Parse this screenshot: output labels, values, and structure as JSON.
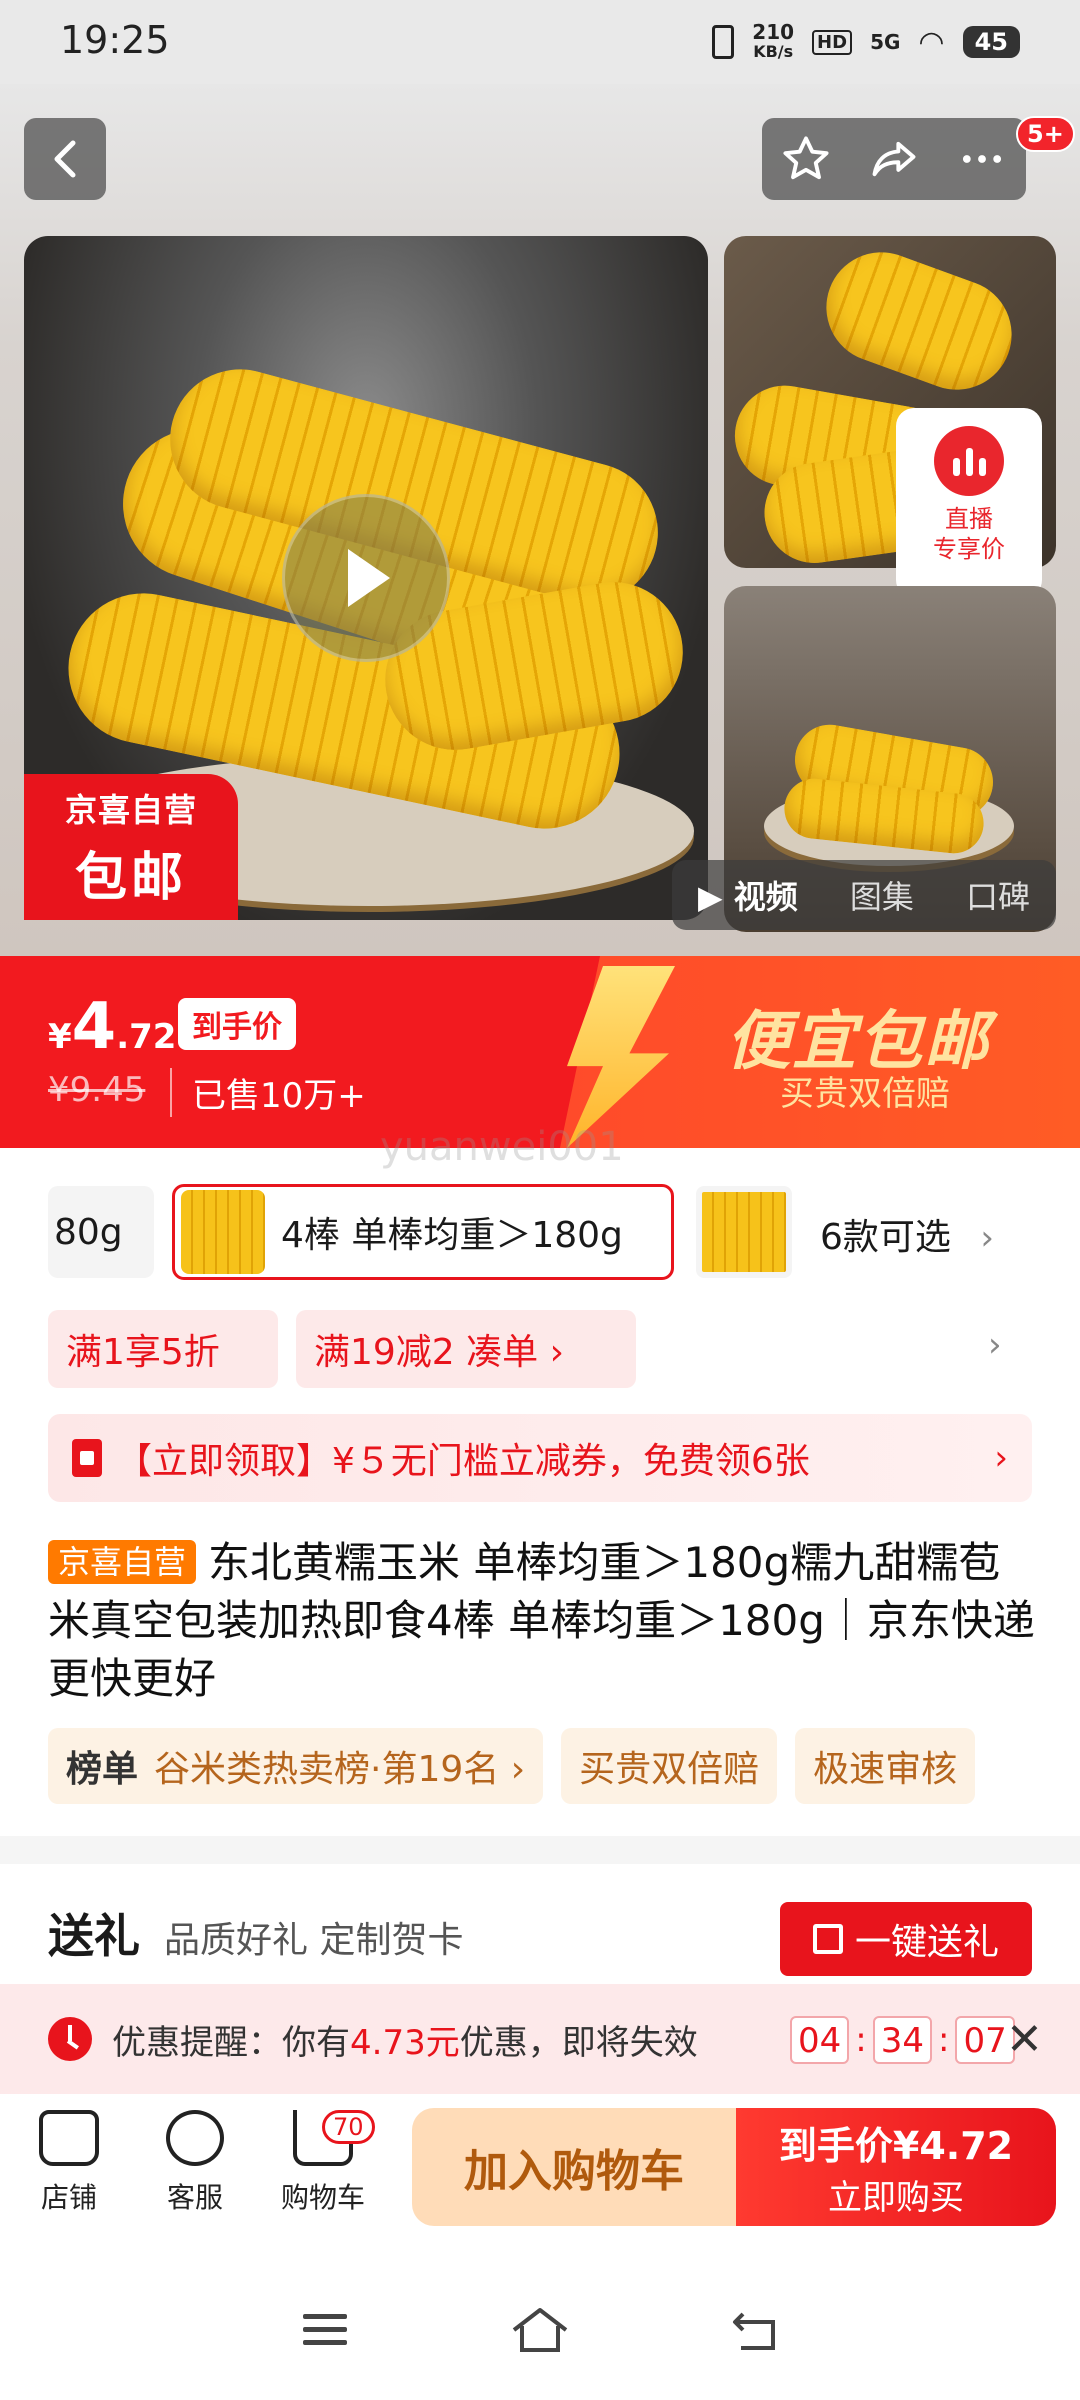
{
  "status_bar": {
    "time": "19:25",
    "net_speed_value": "210",
    "net_speed_unit": "KB/s",
    "hd": "HD",
    "network": "5G",
    "battery": "45"
  },
  "top_nav": {
    "more_badge": "5+"
  },
  "gallery": {
    "badge_line1": "京喜自营",
    "badge_line2": "包邮",
    "live_line1": "直播",
    "live_line2": "专享价",
    "tabs": [
      "视频",
      "图集",
      "口碑"
    ]
  },
  "price": {
    "currency": "¥",
    "integer": "4",
    "decimal": ".72",
    "final_label": "到手价",
    "original": "¥9.45",
    "sold": "已售10万+",
    "promo_title": "便宜包邮",
    "promo_sub": "买贵双倍赔"
  },
  "watermark": "yuanwei001",
  "variants": {
    "prev_label": "80g",
    "selected_label": "4棒 单棒均重＞180g",
    "more_label": "6款可选"
  },
  "promotions": {
    "tag1": "满1享5折",
    "tag2": "满19减2  凑单 ›"
  },
  "coupon": {
    "text": "【立即领取】¥５无门槛立减券，免费领6张"
  },
  "product": {
    "tag": "京喜自营",
    "title": "东北黄糯玉米 单棒均重＞180g糯九甜糯苞米真空包装加热即食4棒 单棒均重＞180g｜京东快递 更快更好"
  },
  "rank": {
    "label": "榜单",
    "value": "谷米类热卖榜·第19名 ›",
    "tag2": "买贵双倍赔",
    "tag3": "极速审核"
  },
  "gift": {
    "title": "送礼",
    "subtitle": "品质好礼 定制贺卡",
    "button": "一键送礼"
  },
  "reminder": {
    "prefix": "优惠提醒：你有",
    "amount": "4.73元",
    "suffix": "优惠，即将失效",
    "hours": "04",
    "minutes": "34",
    "seconds": "07"
  },
  "bottom_bar": {
    "shop": "店铺",
    "service": "客服",
    "cart": "购物车",
    "cart_count": "70",
    "add_to_cart": "加入购物车",
    "buy_line1": "到手价¥4.72",
    "buy_line2": "立即购买"
  },
  "colors": {
    "brand_red": "#e8141c",
    "accent_orange": "#ff7a00",
    "cart_button_bg": "#ffdcb8"
  }
}
